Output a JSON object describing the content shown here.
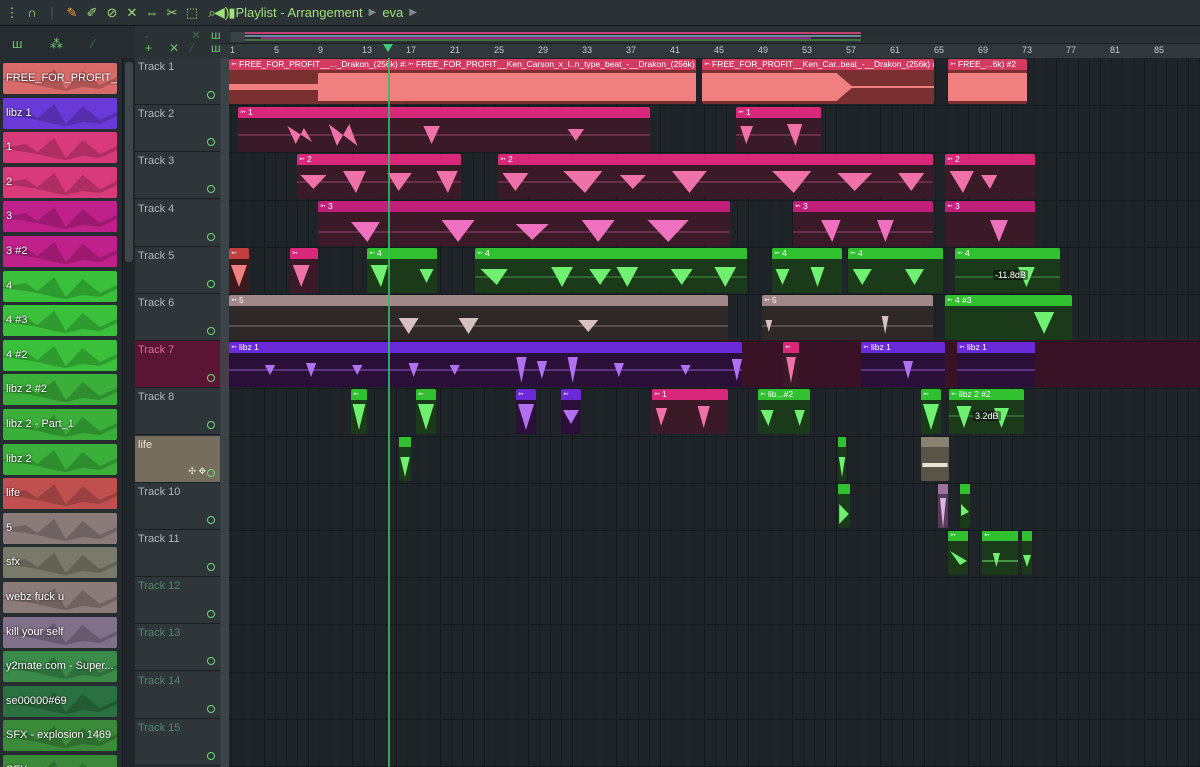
{
  "toolbar": {
    "title": "Playlist - Arrangement",
    "pattern": "eva",
    "icons": [
      "magnet-icon",
      "pencil-icon",
      "paint-icon",
      "delete-icon",
      "mute-icon",
      "slip-icon",
      "select-icon",
      "zoom-icon",
      "playback-icon"
    ]
  },
  "timeline": {
    "bars": [
      "1",
      "5",
      "9",
      "13",
      "17",
      "21",
      "25",
      "29",
      "33",
      "37",
      "41",
      "45",
      "49",
      "53",
      "57",
      "61",
      "65",
      "69",
      "73",
      "77",
      "81",
      "85"
    ]
  },
  "picker": {
    "clips": [
      {
        "name": "FREE_FOR_PROFIT__",
        "color": "#d96a6a"
      },
      {
        "name": "libz 1",
        "color": "#6a3ad8"
      },
      {
        "name": "1",
        "color": "#d83a7a"
      },
      {
        "name": "2",
        "color": "#d83a7a"
      },
      {
        "name": "3",
        "color": "#c0208a"
      },
      {
        "name": "3 #2",
        "color": "#c0208a"
      },
      {
        "name": "4",
        "color": "#3ac03a"
      },
      {
        "name": "4 #3",
        "color": "#3ac03a"
      },
      {
        "name": "4 #2",
        "color": "#3ac03a"
      },
      {
        "name": "libz 2 #2",
        "color": "#3ab03a"
      },
      {
        "name": "libz 2 - Part_1",
        "color": "#3ab03a"
      },
      {
        "name": "libz 2",
        "color": "#3ab03a"
      },
      {
        "name": "life",
        "color": "#c05050"
      },
      {
        "name": "5",
        "color": "#8a7a7a"
      },
      {
        "name": "sfx",
        "color": "#7a7a6a"
      },
      {
        "name": "webz fuck u",
        "color": "#8a7a78"
      },
      {
        "name": "kill your self",
        "color": "#80708a"
      },
      {
        "name": "y2mate.com - Super...",
        "color": "#3a8a4a"
      },
      {
        "name": "se00000#69",
        "color": "#2a7040"
      },
      {
        "name": "SFX - explosion 1469",
        "color": "#3a8a3a"
      },
      {
        "name": "SFX",
        "color": "#3a8a3a"
      }
    ]
  },
  "tracks": [
    {
      "name": "Track 1"
    },
    {
      "name": "Track 2"
    },
    {
      "name": "Track 3"
    },
    {
      "name": "Track 4"
    },
    {
      "name": "Track 5"
    },
    {
      "name": "Track 6"
    },
    {
      "name": "Track 7"
    },
    {
      "name": "Track 8"
    },
    {
      "name": "life"
    },
    {
      "name": "Track 10"
    },
    {
      "name": "Track 11"
    },
    {
      "name": "Track 12"
    },
    {
      "name": "Track 13"
    },
    {
      "name": "Track 14"
    },
    {
      "name": "Track 15"
    }
  ],
  "patterns": {
    "t1a": "FREE_FOR_PROFIT__..._Drakon_(256k) #2",
    "t1b": "FREE_FOR_PROFIT__Ken_Carson_x_I..n_type_beat_-__Drakon_(256k) #2",
    "t1c": "FREE_FOR_PROFIT__Ken_Car..beat_-__Drakon_(256k) #2",
    "t1d": "FREE_...6k) #2",
    "one": "1",
    "two": "2",
    "three": "3",
    "four": "4",
    "four3": "4 #3",
    "five": "5",
    "libz1": "libz 1",
    "libz2a": "lib...#2",
    "libz2b": "libz 2 #2"
  },
  "volumes": {
    "t5": "-11.8dB",
    "t8": "3.2dB"
  },
  "colors": {
    "salmon": "#f08080",
    "pink": "#d8287a",
    "magenta": "#c0207a",
    "green": "#30c030",
    "taupe": "#a08888",
    "purple": "#6a2ad8",
    "selected": "#5a1535"
  }
}
